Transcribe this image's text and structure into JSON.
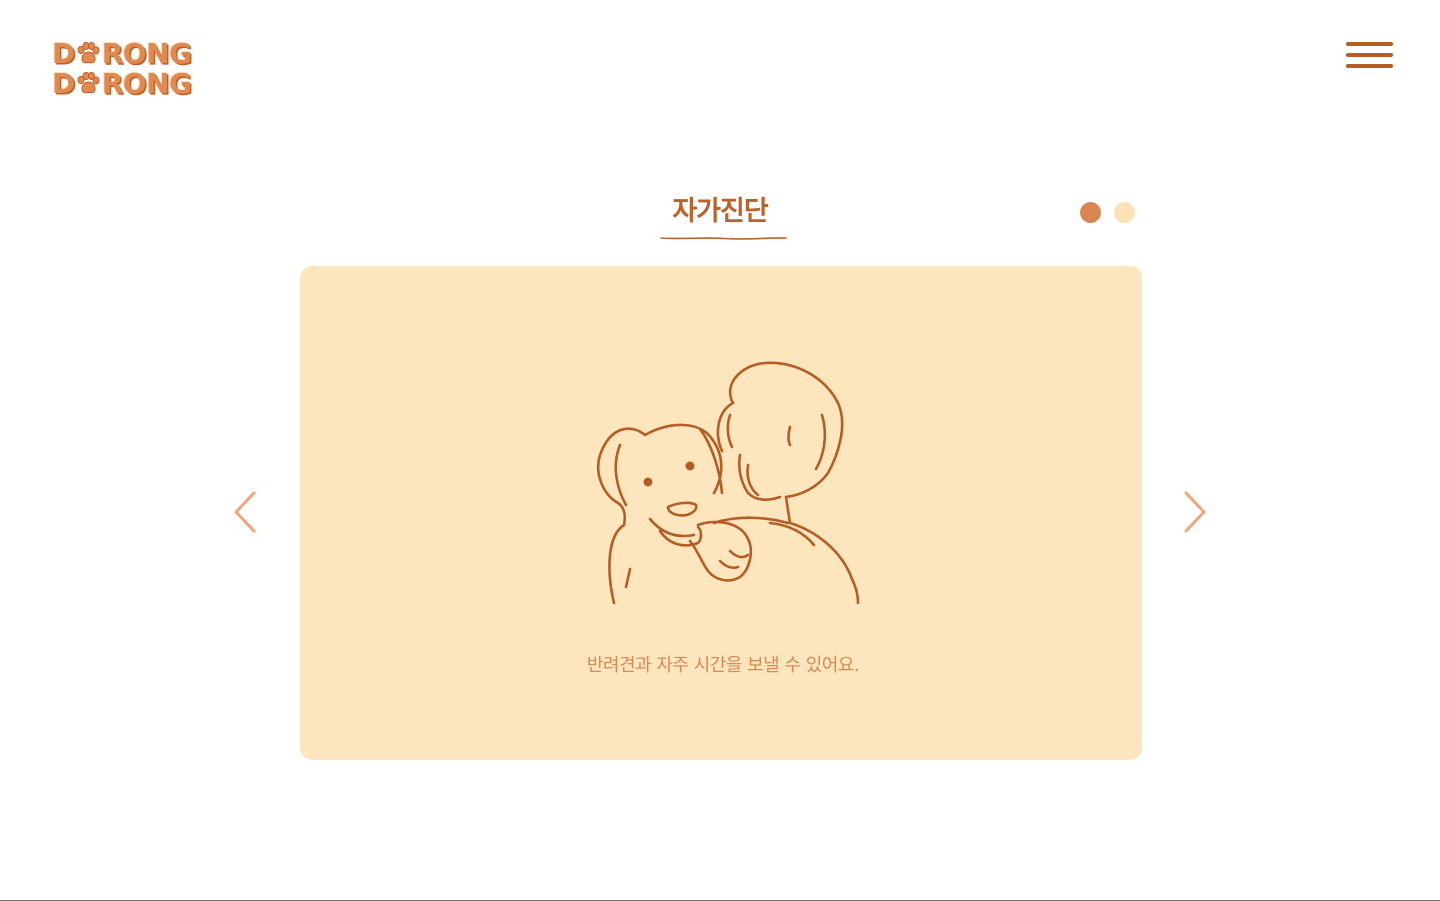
{
  "header": {
    "logo_line1_start": "D",
    "logo_line1_end": "RONG",
    "logo_line2_start": "D",
    "logo_line2_end": "RONG",
    "menu_icon": "hamburger-menu-icon"
  },
  "section": {
    "title": "자가진단"
  },
  "slider": {
    "total_slides": 2,
    "active_slide": 1,
    "prev_icon": "chevron-left-icon",
    "next_icon": "chevron-right-icon"
  },
  "card": {
    "illustration": "person-hugging-dog-illustration",
    "caption": "반려견과 자주 시간을 보낼 수 있어요."
  },
  "colors": {
    "brand_brown": "#b65d23",
    "logo_orange": "#e08a52",
    "card_background": "#fde6bd",
    "dot_active": "#d98654",
    "dot_inactive": "#fbe3b7",
    "arrow": "#f1a57c",
    "caption": "#d98a52"
  }
}
